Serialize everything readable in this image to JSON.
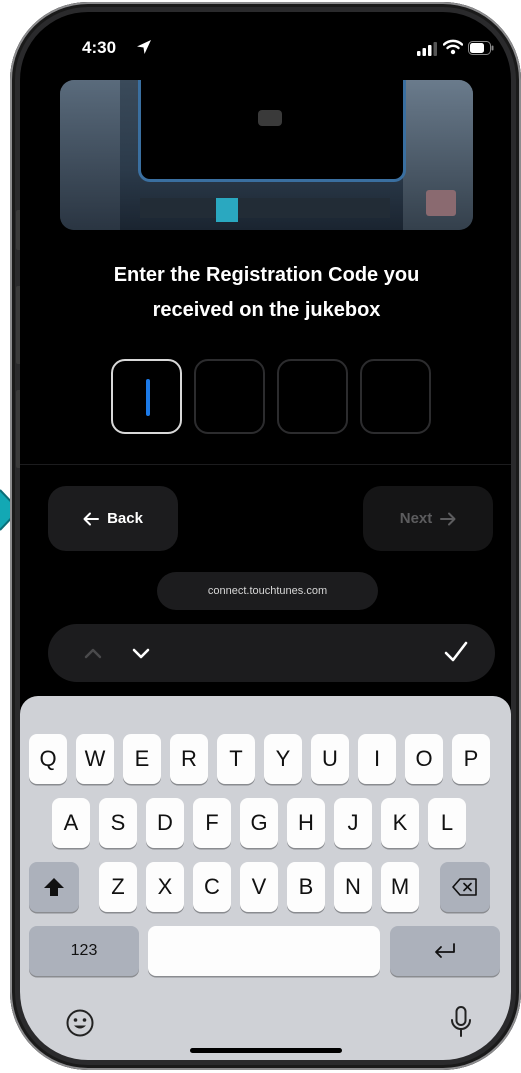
{
  "status_bar": {
    "time": "4:30",
    "icons": [
      "location-arrow-icon",
      "cellular-signal-icon",
      "wifi-icon",
      "battery-icon"
    ]
  },
  "prompt": {
    "line1": "Enter the Registration Code you",
    "line2": "received on the jukebox"
  },
  "code_entry": {
    "digits": [
      "",
      "",
      "",
      ""
    ],
    "active_index": 0,
    "caret_color": "#1c7ae8"
  },
  "nav": {
    "back_label": "Back",
    "next_label": "Next",
    "next_disabled": true
  },
  "url": "connect.touchtunes.com",
  "keyboard": {
    "row1": [
      "Q",
      "W",
      "E",
      "R",
      "T",
      "Y",
      "U",
      "I",
      "O",
      "P"
    ],
    "row2": [
      "A",
      "S",
      "D",
      "F",
      "G",
      "H",
      "J",
      "K",
      "L"
    ],
    "row3": [
      "Z",
      "X",
      "C",
      "V",
      "B",
      "N",
      "M"
    ],
    "numbers_label": "123"
  },
  "colors": {
    "accent": "#1c7ae8",
    "arrow_marker": "#13a8b4",
    "button_bg": "#1c1c1e",
    "keyboard_bg": "#cfd1d6"
  }
}
